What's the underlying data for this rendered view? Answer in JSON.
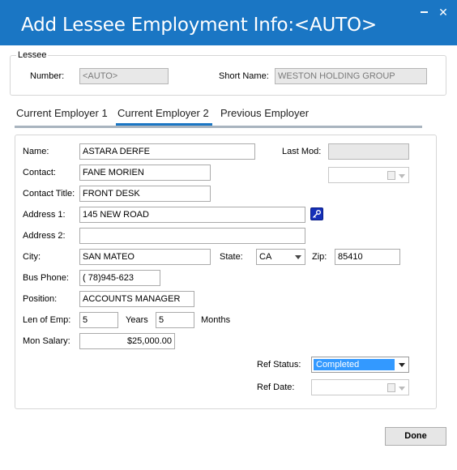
{
  "window": {
    "title": "Add Lessee Employment Info:<AUTO>",
    "minimize_glyph": "",
    "close_glyph": "✕"
  },
  "lessee": {
    "legend": "Lessee",
    "number_label": "Number:",
    "number_value": "<AUTO>",
    "short_name_label": "Short Name:",
    "short_name_value": "WESTON HOLDING GROUP"
  },
  "tabs": [
    {
      "label": "Current Employer 1",
      "active": false
    },
    {
      "label": "Current Employer 2",
      "active": true
    },
    {
      "label": "Previous Employer",
      "active": false
    }
  ],
  "form": {
    "name_label": "Name:",
    "name_value": "ASTARA DERFE",
    "last_mod_label": "Last Mod:",
    "last_mod_value": "",
    "contact_label": "Contact:",
    "contact_value": "FANE MORIEN",
    "contact_title_label": "Contact Title:",
    "contact_title_value": "FRONT DESK",
    "address1_label": "Address 1:",
    "address1_value": "145 NEW ROAD",
    "address2_label": "Address 2:",
    "address2_value": "",
    "city_label": "City:",
    "city_value": "SAN MATEO",
    "state_label": "State:",
    "state_value": "CA",
    "zip_label": "Zip:",
    "zip_value": "85410",
    "bus_phone_label": "Bus Phone:",
    "bus_phone_value": "( 78)945-623",
    "position_label": "Position:",
    "position_value": "ACCOUNTS MANAGER",
    "len_emp_label": "Len of Emp:",
    "years_value": "5",
    "years_label": "Years",
    "months_value": "5",
    "months_label": "Months",
    "mon_salary_label": "Mon Salary:",
    "mon_salary_value": "$25,000.00",
    "ref_status_label": "Ref Status:",
    "ref_status_value": "Completed",
    "ref_date_label": "Ref Date:",
    "ref_date_value": ""
  },
  "done_label": "Done",
  "icons": {
    "lookup": "key-icon",
    "calendar": "calendar-icon"
  },
  "colors": {
    "titlebar": "#1a76c4",
    "selection": "#3399ff",
    "lookup_button": "#1530b8"
  }
}
